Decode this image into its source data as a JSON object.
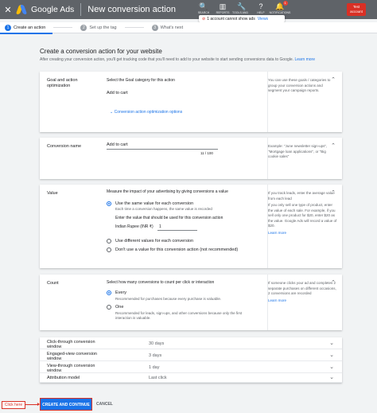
{
  "topbar": {
    "close_icon": "close-icon",
    "brand": "Google Ads",
    "title": "New conversion action",
    "tools": [
      {
        "icon": "search-icon",
        "glyph": "🔍",
        "label": "SEARCH"
      },
      {
        "icon": "reports-icon",
        "glyph": "▥",
        "label": "REPORTS"
      },
      {
        "icon": "tools-icon",
        "glyph": "🔧",
        "label": "TOOLS AND SETTINGS"
      },
      {
        "icon": "help-icon",
        "glyph": "?",
        "label": "HELP"
      },
      {
        "icon": "bell-icon",
        "glyph": "🔔",
        "label": "NOTIFICATIONS",
        "badge": "1"
      }
    ],
    "account": "Test account"
  },
  "warning": {
    "text": "1 account cannot show ads",
    "link": "Views"
  },
  "stepper": {
    "steps": [
      {
        "num": "1",
        "label": "Create an action",
        "active": true
      },
      {
        "num": "2",
        "label": "Set up the tag",
        "active": false
      },
      {
        "num": "3",
        "label": "What's next",
        "active": false
      }
    ]
  },
  "main": {
    "heading": "Create a conversion action for your website",
    "subtitle": "After creating your conversion action, you'll get tracking code that you'll need to add to your website to start sending conversions data to Google.",
    "subtitle_link": "Learn more"
  },
  "goal_card": {
    "label": "Goal and action optimization",
    "placeholder": "Select the Goal category for this action",
    "value": "Add to cart",
    "link": "Conversion action optimization options",
    "help": "You can use these goals / categories to group your conversion actions and segment your campaign reports."
  },
  "name_card": {
    "label": "Conversion name",
    "value": "Add to cart",
    "counter": "11 / 100",
    "help": "Example: \"June newsletter sign-ups\", \"Mortgage loan applications\", or \"Big cookie sales\""
  },
  "value_card": {
    "label": "Value",
    "description": "Measure the impact of your advertising by giving conversions a value",
    "opt1": "Use the same value for each conversion",
    "opt1_desc": "Each time a conversion happens, the same value is recorded",
    "enter_label": "Enter the value that should be used for this conversion action",
    "currency": "Indian Rupee (INR ₹)",
    "amount": "1",
    "opt2": "Use different values for each conversion",
    "opt3": "Don't use a value for this conversion action (not recommended)",
    "help1": "If you track leads, enter the average value from each lead",
    "help2": "If you only sell one type of product, enter the value of each sale. For example, if you sell only one product for $20, enter $20 as the value. Google Ads will record a value of $20.",
    "help_link": "Learn more"
  },
  "count_card": {
    "label": "Count",
    "description": "Select how many conversions to count per click or interaction",
    "opt1": "Every",
    "opt1_desc": "Recommended for purchases because every purchase is valuable.",
    "opt2": "One",
    "opt2_desc": "Recommended for leads, sign-ups, and other conversions because only the first interaction is valuable.",
    "help": "If someone clicks your ad and completes 2 separate purchases on different occasions, 2 conversions are recorded",
    "help_link": "Learn more"
  },
  "settings_rows": [
    {
      "label": "Click-through conversion window",
      "value": "30 days"
    },
    {
      "label": "Engaged-view conversion window",
      "value": "3 days"
    },
    {
      "label": "View-through conversion window",
      "value": "1 day"
    },
    {
      "label": "Attribution model",
      "value": "Last click"
    }
  ],
  "actions": {
    "primary": "CREATE AND CONTINUE",
    "cancel": "CANCEL",
    "annotation": "Click here"
  },
  "colors": {
    "accent": "#1a73e8",
    "topbar": "#5f6368",
    "alert": "#d93025"
  }
}
